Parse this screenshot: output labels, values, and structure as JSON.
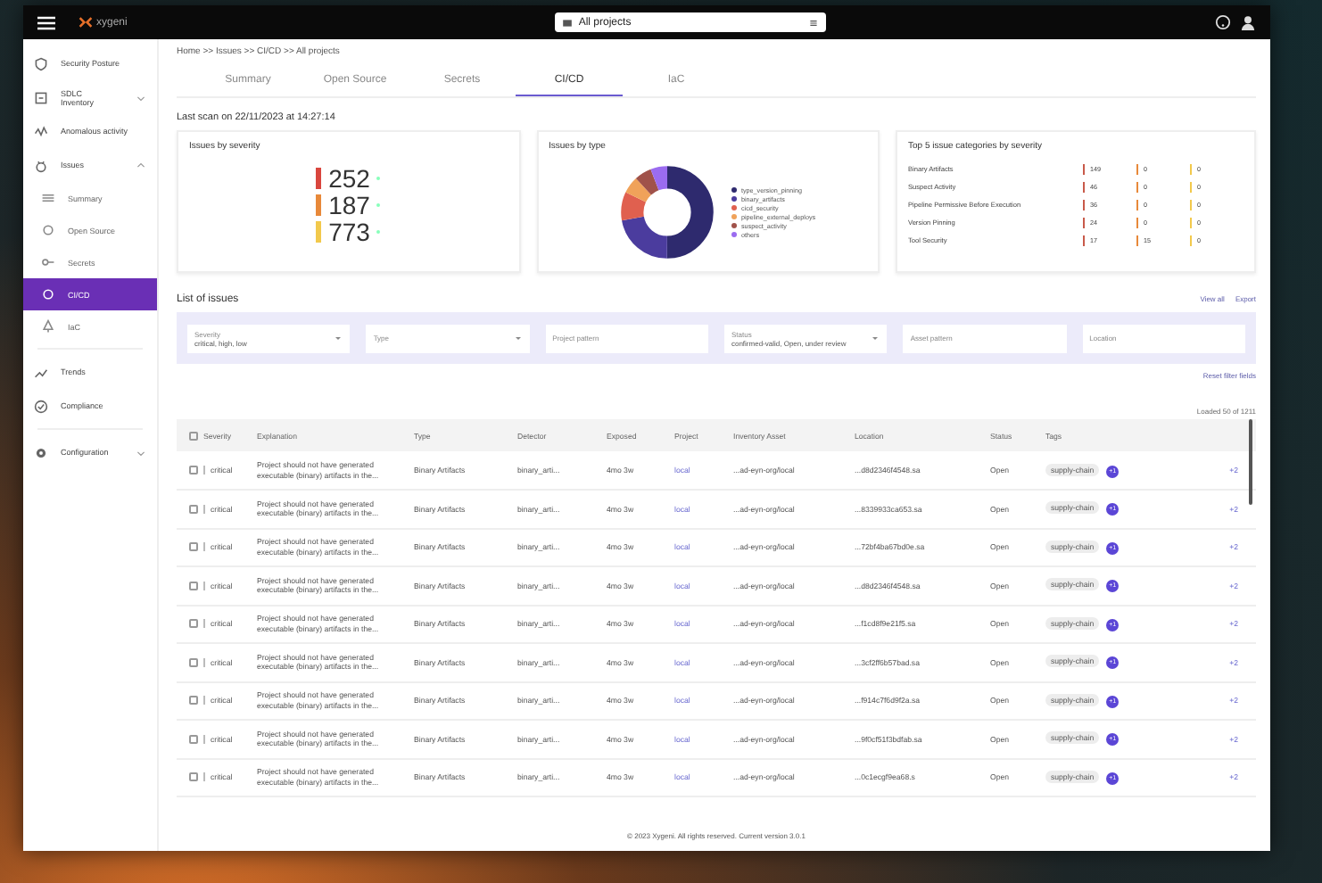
{
  "topbar": {
    "logo": "xygeni",
    "project_select": "All projects"
  },
  "sidebar": {
    "items": [
      {
        "label": "Security Posture",
        "selected": false
      },
      {
        "label": "SDLC Inventory",
        "expanded": false,
        "selected": false
      },
      {
        "label": "Anomalous activity",
        "selected": false
      },
      {
        "label": "Issues",
        "expanded": true,
        "selected": false,
        "children": [
          {
            "label": "Summary",
            "selected": false
          },
          {
            "label": "Open Source",
            "selected": false
          },
          {
            "label": "Secrets",
            "selected": false
          },
          {
            "label": "CI/CD",
            "selected": true
          },
          {
            "label": "IaC",
            "selected": false
          }
        ]
      },
      {
        "label": "Trends",
        "selected": false
      },
      {
        "label": "Compliance",
        "selected": false
      },
      {
        "label": "Configuration",
        "expanded": false,
        "selected": false
      }
    ]
  },
  "breadcrumb": "Home >> Issues >> CI/CD >> All projects",
  "tabs": [
    {
      "label": "Summary",
      "selected": false
    },
    {
      "label": "Open Source",
      "selected": false
    },
    {
      "label": "Secrets",
      "selected": false
    },
    {
      "label": "CI/CD",
      "selected": true
    },
    {
      "label": "IaC",
      "selected": false
    }
  ],
  "last_scan": "Last scan on 22/11/2023 at 14:27:14",
  "severity_card": {
    "title": "Issues by severity",
    "items": [
      {
        "count": "252",
        "color": "#d9463e"
      },
      {
        "count": "187",
        "color": "#e8893a"
      },
      {
        "count": "773",
        "color": "#f2c94c"
      }
    ]
  },
  "type_card": {
    "title": "Issues by type",
    "legend": [
      {
        "label": "type_version_pinning",
        "color": "#2e2a6e"
      },
      {
        "label": "binary_artifacts",
        "color": "#4b3c9e"
      },
      {
        "label": "cicd_security",
        "color": "#e0604f"
      },
      {
        "label": "pipeline_external_deploys",
        "color": "#f0a25a"
      },
      {
        "label": "suspect_activity",
        "color": "#a0524a"
      },
      {
        "label": "others",
        "color": "#9b6cf0"
      }
    ]
  },
  "top5_card": {
    "title": "Top 5 issue categories by severity",
    "rows": [
      {
        "name": "Binary Artifacts",
        "values": [
          "149",
          "0",
          "0"
        ]
      },
      {
        "name": "Suspect Activity",
        "values": [
          "46",
          "0",
          "0"
        ]
      },
      {
        "name": "Pipeline Permissive Before Execution",
        "values": [
          "36",
          "0",
          "0"
        ]
      },
      {
        "name": "Version Pinning",
        "values": [
          "24",
          "0",
          "0"
        ]
      },
      {
        "name": "Tool Security",
        "values": [
          "17",
          "15",
          "0"
        ]
      }
    ]
  },
  "list": {
    "title": "List of issues",
    "view_all": "View all",
    "export": "Export",
    "filters": [
      {
        "kind": "select",
        "label": "Severity",
        "value": "critical, high, low"
      },
      {
        "kind": "select",
        "placeholder": "Type"
      },
      {
        "kind": "input",
        "placeholder": "Project pattern"
      },
      {
        "kind": "select",
        "label": "Status",
        "value": "confirmed-valid, Open, under review"
      },
      {
        "kind": "input",
        "placeholder": "Asset pattern"
      },
      {
        "kind": "input",
        "placeholder": "Location"
      }
    ],
    "reset": "Reset filter fields",
    "loaded": "Loaded 50 of 1211"
  },
  "table": {
    "header_checked": false,
    "columns": [
      "Severity",
      "Explanation",
      "Type",
      "Detector",
      "Exposed",
      "Project",
      "Inventory Asset",
      "Location",
      "Status",
      "Tags"
    ],
    "rows": [
      {
        "checked": false,
        "severity": "critical",
        "explanation": "Project should not have generated executable (binary) artifacts in the...",
        "type": "Binary Artifacts",
        "detector": "binary_arti...",
        "exposed": "4mo 3w",
        "project": "local",
        "asset": "...ad-eyn-org/local",
        "location": "...d8d2346f4548.sa",
        "status": "Open",
        "tag": "supply-chain",
        "tag_count": "+1",
        "more": "+2"
      },
      {
        "checked": false,
        "severity": "critical",
        "explanation": "Project should not have generated executable (binary) artifacts in the...",
        "type": "Binary Artifacts",
        "detector": "binary_arti...",
        "exposed": "4mo 3w",
        "project": "local",
        "asset": "...ad-eyn-org/local",
        "location": "...8339933ca653.sa",
        "status": "Open",
        "tag": "supply-chain",
        "tag_count": "+1",
        "more": "+2"
      },
      {
        "checked": false,
        "severity": "critical",
        "explanation": "Project should not have generated executable (binary) artifacts in the...",
        "type": "Binary Artifacts",
        "detector": "binary_arti...",
        "exposed": "4mo 3w",
        "project": "local",
        "asset": "...ad-eyn-org/local",
        "location": "...72bf4ba67bd0e.sa",
        "status": "Open",
        "tag": "supply-chain",
        "tag_count": "+1",
        "more": "+2"
      },
      {
        "checked": false,
        "severity": "critical",
        "explanation": "Project should not have generated executable (binary) artifacts in the...",
        "type": "Binary Artifacts",
        "detector": "binary_arti...",
        "exposed": "4mo 3w",
        "project": "local",
        "asset": "...ad-eyn-org/local",
        "location": "...d8d2346f4548.sa",
        "status": "Open",
        "tag": "supply-chain",
        "tag_count": "+1",
        "more": "+2"
      },
      {
        "checked": false,
        "severity": "critical",
        "explanation": "Project should not have generated executable (binary) artifacts in the...",
        "type": "Binary Artifacts",
        "detector": "binary_arti...",
        "exposed": "4mo 3w",
        "project": "local",
        "asset": "...ad-eyn-org/local",
        "location": "...f1cd8f9e21f5.sa",
        "status": "Open",
        "tag": "supply-chain",
        "tag_count": "+1",
        "more": "+2"
      },
      {
        "checked": false,
        "severity": "critical",
        "explanation": "Project should not have generated executable (binary) artifacts in the...",
        "type": "Binary Artifacts",
        "detector": "binary_arti...",
        "exposed": "4mo 3w",
        "project": "local",
        "asset": "...ad-eyn-org/local",
        "location": "...3cf2ff6b57bad.sa",
        "status": "Open",
        "tag": "supply-chain",
        "tag_count": "+1",
        "more": "+2"
      },
      {
        "checked": false,
        "severity": "critical",
        "explanation": "Project should not have generated executable (binary) artifacts in the...",
        "type": "Binary Artifacts",
        "detector": "binary_arti...",
        "exposed": "4mo 3w",
        "project": "local",
        "asset": "...ad-eyn-org/local",
        "location": "...f914c7f6d9f2a.sa",
        "status": "Open",
        "tag": "supply-chain",
        "tag_count": "+1",
        "more": "+2"
      },
      {
        "checked": false,
        "severity": "critical",
        "explanation": "Project should not have generated executable (binary) artifacts in the...",
        "type": "Binary Artifacts",
        "detector": "binary_arti...",
        "exposed": "4mo 3w",
        "project": "local",
        "asset": "...ad-eyn-org/local",
        "location": "...9f0cf51f3bdfab.sa",
        "status": "Open",
        "tag": "supply-chain",
        "tag_count": "+1",
        "more": "+2"
      },
      {
        "checked": false,
        "severity": "critical",
        "explanation": "Project should not have generated executable (binary) artifacts in the...",
        "type": "Binary Artifacts",
        "detector": "binary_arti...",
        "exposed": "4mo 3w",
        "project": "local",
        "asset": "...ad-eyn-org/local",
        "location": "...0c1ecgf9ea68.s",
        "status": "Open",
        "tag": "supply-chain",
        "tag_count": "+1",
        "more": "+2"
      }
    ]
  },
  "footer": "© 2023 Xygeni. All rights reserved. Current version 3.0.1"
}
